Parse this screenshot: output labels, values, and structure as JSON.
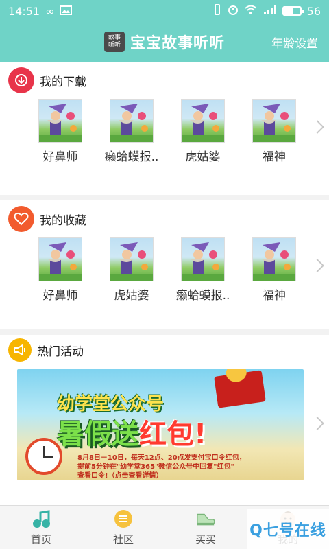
{
  "status_bar": {
    "time": "14:51",
    "battery_level": "56",
    "battery_fraction": 0.56
  },
  "header": {
    "logo_top": "故事",
    "logo_bottom": "听听",
    "title": "宝宝故事听听",
    "age_setting": "年龄设置"
  },
  "downloads": {
    "title": "我的下载",
    "items": [
      {
        "title": "好鼻师"
      },
      {
        "title": "癞蛤蟆报.."
      },
      {
        "title": "虎姑婆"
      },
      {
        "title": "福神"
      }
    ]
  },
  "favorites": {
    "title": "我的收藏",
    "items": [
      {
        "title": "好鼻师"
      },
      {
        "title": "虎姑婆"
      },
      {
        "title": "癞蛤蟆报.."
      },
      {
        "title": "福神"
      }
    ]
  },
  "activities": {
    "title": "热门活动",
    "banner": {
      "line1": "幼学堂公众号",
      "line2a": "暑假送",
      "line2b": "红包!",
      "detail1": "8月8日－10日，每天12点、20点发支付宝口令红包，",
      "detail2": "提前5分钟在\"幼学堂365\"微信公众号中回复\"红包\"",
      "detail3": "查看口令!（点击查看详情）"
    }
  },
  "tabs": [
    {
      "label": "首页",
      "icon": "music-note-icon"
    },
    {
      "label": "社区",
      "icon": "menu-circle-icon"
    },
    {
      "label": "买买",
      "icon": "shoe-icon"
    },
    {
      "label": "我的",
      "icon": "baby-face-icon"
    }
  ],
  "watermark": "Q七号在线",
  "colors": {
    "accent": "#6fd3c7",
    "download_icon": "#e8344a",
    "favorite_icon": "#f25b2e",
    "activity_icon": "#f7b500"
  }
}
